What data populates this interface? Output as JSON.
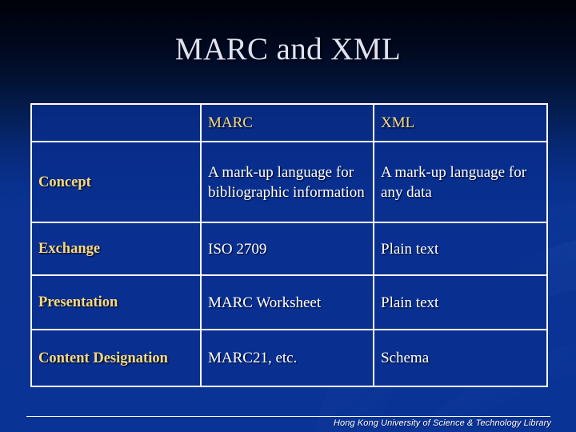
{
  "slide": {
    "title": "MARC and XML",
    "background_top_color": "#000109",
    "background_bottom_color": "#0a3396",
    "accent_gold": "#f7d97c",
    "text_white": "#ffffff",
    "title_color": "#dfe2f2",
    "border_color": "#ffffff"
  },
  "table": {
    "headers": [
      "",
      "MARC",
      "XML"
    ],
    "rows": [
      {
        "label": "Concept",
        "marc": "A mark-up language for bibliographic information",
        "xml": "A mark-up language for any data"
      },
      {
        "label": "Exchange",
        "marc": "ISO 2709",
        "xml": "Plain text"
      },
      {
        "label": "Presentation",
        "marc": "MARC Worksheet",
        "xml": "Plain text"
      },
      {
        "label": "Content Designation",
        "marc": "MARC21, etc.",
        "xml": "Schema"
      }
    ]
  },
  "footer": {
    "text": "Hong Kong University of Science & Technology Library"
  }
}
